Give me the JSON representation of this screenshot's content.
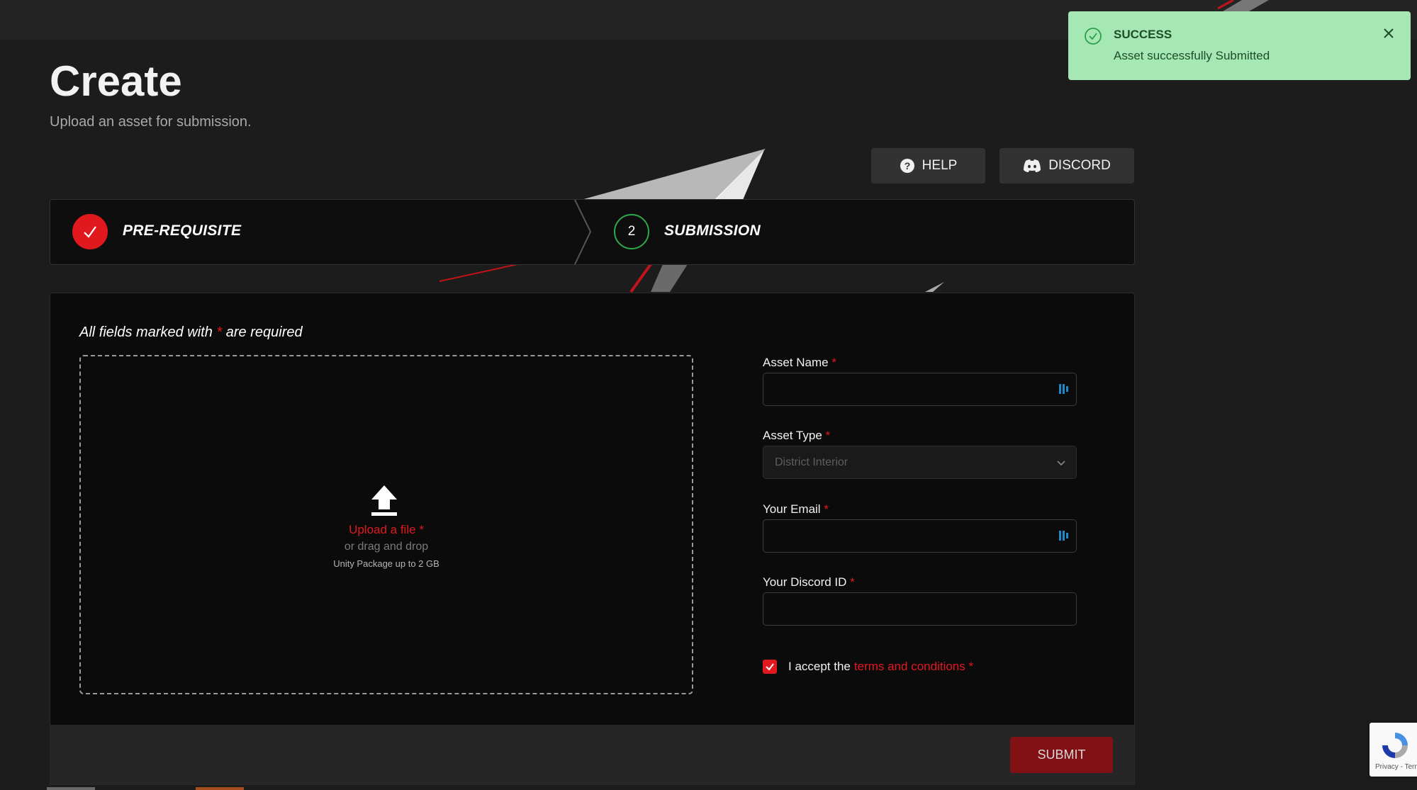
{
  "header": {
    "title": "Create",
    "subtitle": "Upload an asset for submission."
  },
  "actions": {
    "help_label": "HELP",
    "discord_label": "DISCORD"
  },
  "stepper": {
    "steps": [
      {
        "label": "PRE-REQUISITE",
        "status": "complete"
      },
      {
        "number": "2",
        "label": "SUBMISSION",
        "status": "current"
      }
    ]
  },
  "form": {
    "required_note_prefix": "All fields marked with",
    "required_star": "*",
    "required_note_suffix": "are required",
    "upload": {
      "link_text": "Upload a file",
      "subtext": "or drag and drop",
      "hint": "Unity Package up to 2 GB"
    },
    "fields": {
      "asset_name": {
        "label": "Asset Name",
        "value": ""
      },
      "asset_type": {
        "label": "Asset Type",
        "selected": "District Interior"
      },
      "email": {
        "label": "Your Email",
        "value": ""
      },
      "discord_id": {
        "label": "Your Discord ID",
        "value": ""
      }
    },
    "terms": {
      "checked": true,
      "prefix": "I accept the",
      "link_text": "terms and conditions"
    },
    "submit_label": "SUBMIT"
  },
  "toast": {
    "title": "SUCCESS",
    "message": "Asset successfully Submitted"
  },
  "recaptcha": {
    "text": "Privacy - Terms"
  },
  "colors": {
    "accent_red": "#e2181f",
    "success_green": "#a5e8b3",
    "background": "#1c1c1c"
  }
}
